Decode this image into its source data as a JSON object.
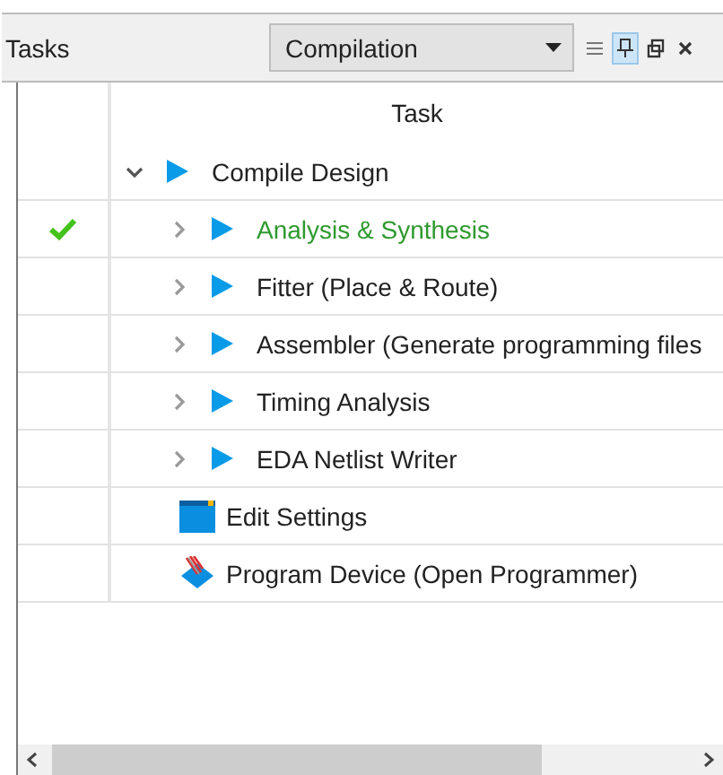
{
  "panel": {
    "title": "Tasks",
    "flow_dropdown": {
      "value": "Compilation"
    },
    "toolbar": [
      {
        "kind": "menu",
        "on": false
      },
      {
        "kind": "pin",
        "on": true
      },
      {
        "kind": "float",
        "on": false
      },
      {
        "kind": "close",
        "on": false
      }
    ]
  },
  "table": {
    "columns": [
      "Task"
    ],
    "rows": [
      {
        "label": "Compile Design",
        "kind": "run",
        "done": false,
        "expanded": true,
        "children": [
          {
            "label": "Analysis & Synthesis",
            "kind": "run",
            "done": true,
            "expanded": false
          },
          {
            "label": "Fitter (Place & Route)",
            "kind": "run",
            "done": false,
            "expanded": false
          },
          {
            "label": "Assembler (Generate programming files",
            "kind": "run",
            "done": false,
            "expanded": false
          },
          {
            "label": "Timing Analysis",
            "kind": "run",
            "done": false,
            "expanded": false
          },
          {
            "label": "EDA Netlist Writer",
            "kind": "run",
            "done": false,
            "expanded": false
          }
        ]
      },
      {
        "label": "Edit Settings",
        "kind": "settings",
        "done": false
      },
      {
        "label": "Program Device (Open Programmer)",
        "kind": "program",
        "done": false
      }
    ]
  }
}
